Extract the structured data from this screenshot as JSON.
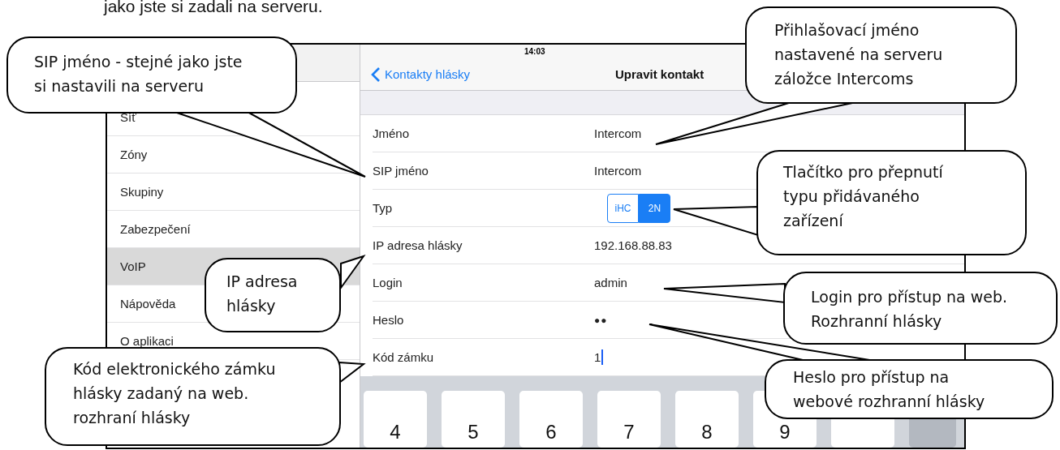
{
  "page_text": "jako jste si zadali na serveru.",
  "status_bar": {
    "time": "14:03"
  },
  "sidebar": {
    "items": [
      {
        "label": "Síť",
        "selected": false
      },
      {
        "label": "Zóny",
        "selected": false
      },
      {
        "label": "Skupiny",
        "selected": false
      },
      {
        "label": "Zabezpečení",
        "selected": false
      },
      {
        "label": "VoIP",
        "selected": true
      },
      {
        "label": "Nápověda",
        "selected": false
      },
      {
        "label": "O aplikaci",
        "selected": false
      }
    ]
  },
  "nav": {
    "back": "Kontakty hlásky",
    "title": "Upravit kontakt"
  },
  "form": {
    "rows": [
      {
        "label": "Jméno",
        "kind": "text",
        "value": "Intercom"
      },
      {
        "label": "SIP jméno",
        "kind": "text",
        "value": "Intercom"
      },
      {
        "label": "Typ",
        "kind": "segmented",
        "options": [
          {
            "label": "iHC",
            "selected": false
          },
          {
            "label": "2N",
            "selected": true
          }
        ]
      },
      {
        "label": "IP adresa hlásky",
        "kind": "text",
        "value": "192.168.88.83"
      },
      {
        "label": "Login",
        "kind": "text",
        "value": "admin"
      },
      {
        "label": "Heslo",
        "kind": "password",
        "value": "●●"
      },
      {
        "label": "Kód zámku",
        "kind": "editing",
        "value": "1"
      }
    ]
  },
  "keyboard": {
    "keys": [
      "4",
      "5",
      "6",
      "7",
      "8",
      "9"
    ]
  },
  "callouts": [
    {
      "text": "SIP jméno - stejné jako jste\nsi nastavili na serveru"
    },
    {
      "text": "Přihlašovací jméno\nnastavené na serveru\nzáložce Intercoms"
    },
    {
      "text": "Tlačítko pro přepnutí\ntypu přidávaného\nzařízení"
    },
    {
      "text": "IP adresa\nhlásky"
    },
    {
      "text": "Login pro přístup na web.\nRozhranní hlásky"
    },
    {
      "text": "Kód elektronického zámku\nhlásky zadaný na web.\nrozhraní hlásky"
    },
    {
      "text": "Heslo pro přístup na\nwebové rozhranní hlásky"
    }
  ]
}
